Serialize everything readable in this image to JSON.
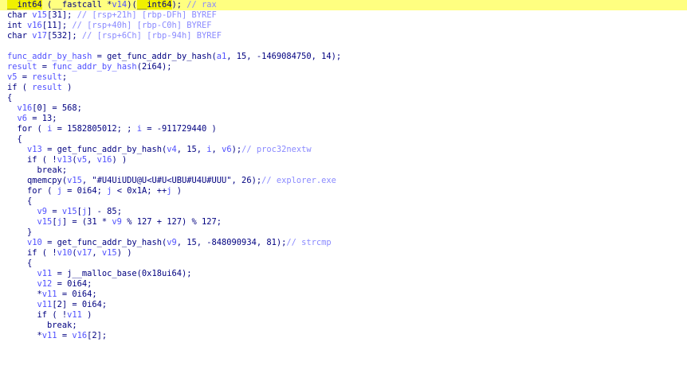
{
  "theme": {
    "background": "#ffffff",
    "text": "#000080",
    "variable": "#5050ff",
    "comment": "#8a8aff",
    "highlight_line": "#ffff80",
    "highlight_token": "#f0f000"
  },
  "lines": [
    {
      "hl": true,
      "tokens": [
        [
          "hl",
          "__int64"
        ],
        [
          "punct",
          " ("
        ],
        [
          "punct",
          "__fastcall "
        ],
        [
          "punct",
          "*"
        ],
        [
          "var",
          "v14"
        ],
        [
          "punct",
          ")("
        ],
        [
          "hl",
          "__int64"
        ],
        [
          "punct",
          ");"
        ],
        [
          "cmt",
          " // rax"
        ]
      ]
    },
    {
      "tokens": [
        [
          "kw",
          "char "
        ],
        [
          "var",
          "v15"
        ],
        [
          "punct",
          "[31]; "
        ],
        [
          "cmt",
          "// [rsp+21h] [rbp-DFh] BYREF"
        ]
      ]
    },
    {
      "tokens": [
        [
          "kw",
          "int "
        ],
        [
          "var",
          "v16"
        ],
        [
          "punct",
          "[11]; "
        ],
        [
          "cmt",
          "// [rsp+40h] [rbp-C0h] BYREF"
        ]
      ]
    },
    {
      "tokens": [
        [
          "kw",
          "char "
        ],
        [
          "var",
          "v17"
        ],
        [
          "punct",
          "[532]; "
        ],
        [
          "cmt",
          "// [rsp+6Ch] [rbp-94h] BYREF"
        ]
      ]
    },
    {
      "tokens": []
    },
    {
      "tokens": [
        [
          "var",
          "func_addr_by_hash"
        ],
        [
          "punct",
          " = get_func_addr_by_hash("
        ],
        [
          "var",
          "a1"
        ],
        [
          "punct",
          ", 15, -1469084750, 14);"
        ]
      ]
    },
    {
      "tokens": [
        [
          "var",
          "result"
        ],
        [
          "punct",
          " = "
        ],
        [
          "var",
          "func_addr_by_hash"
        ],
        [
          "punct",
          "(2i64);"
        ]
      ]
    },
    {
      "tokens": [
        [
          "var",
          "v5"
        ],
        [
          "punct",
          " = "
        ],
        [
          "var",
          "result"
        ],
        [
          "punct",
          ";"
        ]
      ]
    },
    {
      "tokens": [
        [
          "kw",
          "if"
        ],
        [
          "punct",
          " ( "
        ],
        [
          "var",
          "result"
        ],
        [
          "punct",
          " )"
        ]
      ]
    },
    {
      "tokens": [
        [
          "punct",
          "{"
        ]
      ]
    },
    {
      "tokens": [
        [
          "punct",
          "  "
        ],
        [
          "var",
          "v16"
        ],
        [
          "punct",
          "[0] = 568;"
        ]
      ]
    },
    {
      "tokens": [
        [
          "punct",
          "  "
        ],
        [
          "var",
          "v6"
        ],
        [
          "punct",
          " = 13;"
        ]
      ]
    },
    {
      "tokens": [
        [
          "punct",
          "  "
        ],
        [
          "kw",
          "for"
        ],
        [
          "punct",
          " ( "
        ],
        [
          "var",
          "i"
        ],
        [
          "punct",
          " = 1582805012; ; "
        ],
        [
          "var",
          "i"
        ],
        [
          "punct",
          " = -911729440 )"
        ]
      ]
    },
    {
      "tokens": [
        [
          "punct",
          "  {"
        ]
      ]
    },
    {
      "tokens": [
        [
          "punct",
          "    "
        ],
        [
          "var",
          "v13"
        ],
        [
          "punct",
          " = get_func_addr_by_hash("
        ],
        [
          "var",
          "v4"
        ],
        [
          "punct",
          ", 15, "
        ],
        [
          "var",
          "i"
        ],
        [
          "punct",
          ", "
        ],
        [
          "var",
          "v6"
        ],
        [
          "punct",
          ");"
        ],
        [
          "cmt",
          "// proc32nextw"
        ]
      ]
    },
    {
      "tokens": [
        [
          "punct",
          "    "
        ],
        [
          "kw",
          "if"
        ],
        [
          "punct",
          " ( !"
        ],
        [
          "var",
          "v13"
        ],
        [
          "punct",
          "("
        ],
        [
          "var",
          "v5"
        ],
        [
          "punct",
          ", "
        ],
        [
          "var",
          "v16"
        ],
        [
          "punct",
          ") )"
        ]
      ]
    },
    {
      "tokens": [
        [
          "punct",
          "      "
        ],
        [
          "kw",
          "break"
        ],
        [
          "punct",
          ";"
        ]
      ]
    },
    {
      "tokens": [
        [
          "punct",
          "    qmemcpy("
        ],
        [
          "var",
          "v15"
        ],
        [
          "punct",
          ", "
        ],
        [
          "str",
          "\"#U4UiUDU@U<U#U<UBU#U4U#UUU\""
        ],
        [
          "punct",
          ", 26);"
        ],
        [
          "cmt",
          "// explorer.exe"
        ]
      ]
    },
    {
      "tokens": [
        [
          "punct",
          "    "
        ],
        [
          "kw",
          "for"
        ],
        [
          "punct",
          " ( "
        ],
        [
          "var",
          "j"
        ],
        [
          "punct",
          " = 0i64; "
        ],
        [
          "var",
          "j"
        ],
        [
          "punct",
          " < 0x1A; ++"
        ],
        [
          "var",
          "j"
        ],
        [
          "punct",
          " )"
        ]
      ]
    },
    {
      "tokens": [
        [
          "punct",
          "    {"
        ]
      ]
    },
    {
      "tokens": [
        [
          "punct",
          "      "
        ],
        [
          "var",
          "v9"
        ],
        [
          "punct",
          " = "
        ],
        [
          "var",
          "v15"
        ],
        [
          "punct",
          "["
        ],
        [
          "var",
          "j"
        ],
        [
          "punct",
          "] - 85;"
        ]
      ]
    },
    {
      "tokens": [
        [
          "punct",
          "      "
        ],
        [
          "var",
          "v15"
        ],
        [
          "punct",
          "["
        ],
        [
          "var",
          "j"
        ],
        [
          "punct",
          "] = (31 * "
        ],
        [
          "var",
          "v9"
        ],
        [
          "punct",
          " % 127 + 127) % 127;"
        ]
      ]
    },
    {
      "tokens": [
        [
          "punct",
          "    }"
        ]
      ]
    },
    {
      "tokens": [
        [
          "punct",
          "    "
        ],
        [
          "var",
          "v10"
        ],
        [
          "punct",
          " = get_func_addr_by_hash("
        ],
        [
          "var",
          "v9"
        ],
        [
          "punct",
          ", 15, -848090934, 81);"
        ],
        [
          "cmt",
          "// strcmp"
        ]
      ]
    },
    {
      "tokens": [
        [
          "punct",
          "    "
        ],
        [
          "kw",
          "if"
        ],
        [
          "punct",
          " ( !"
        ],
        [
          "var",
          "v10"
        ],
        [
          "punct",
          "("
        ],
        [
          "var",
          "v17"
        ],
        [
          "punct",
          ", "
        ],
        [
          "var",
          "v15"
        ],
        [
          "punct",
          ") )"
        ]
      ]
    },
    {
      "tokens": [
        [
          "punct",
          "    {"
        ]
      ]
    },
    {
      "tokens": [
        [
          "punct",
          "      "
        ],
        [
          "var",
          "v11"
        ],
        [
          "punct",
          " = j__malloc_base(0x18ui64);"
        ]
      ]
    },
    {
      "tokens": [
        [
          "punct",
          "      "
        ],
        [
          "var",
          "v12"
        ],
        [
          "punct",
          " = 0i64;"
        ]
      ]
    },
    {
      "tokens": [
        [
          "punct",
          "      *"
        ],
        [
          "var",
          "v11"
        ],
        [
          "punct",
          " = 0i64;"
        ]
      ]
    },
    {
      "tokens": [
        [
          "punct",
          "      "
        ],
        [
          "var",
          "v11"
        ],
        [
          "punct",
          "[2] = 0i64;"
        ]
      ]
    },
    {
      "tokens": [
        [
          "punct",
          "      "
        ],
        [
          "kw",
          "if"
        ],
        [
          "punct",
          " ( !"
        ],
        [
          "var",
          "v11"
        ],
        [
          "punct",
          " )"
        ]
      ]
    },
    {
      "tokens": [
        [
          "punct",
          "        "
        ],
        [
          "kw",
          "break"
        ],
        [
          "punct",
          ";"
        ]
      ]
    },
    {
      "tokens": [
        [
          "punct",
          "      *"
        ],
        [
          "var",
          "v11"
        ],
        [
          "punct",
          " = "
        ],
        [
          "var",
          "v16"
        ],
        [
          "punct",
          "[2];"
        ]
      ]
    }
  ]
}
